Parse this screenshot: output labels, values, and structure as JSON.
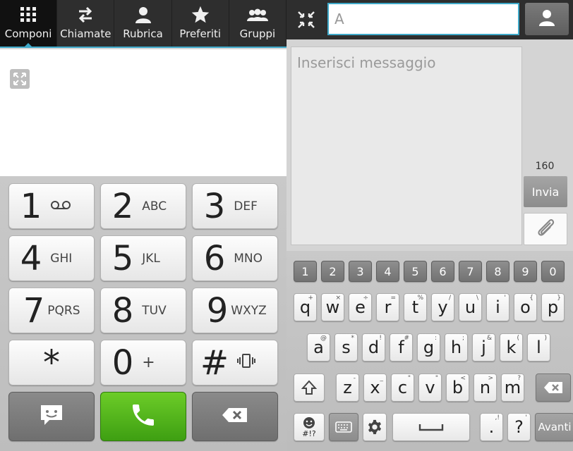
{
  "tabs": [
    {
      "label": "Componi",
      "icon": "dialpad-icon",
      "active": true
    },
    {
      "label": "Chiamate",
      "icon": "swap-arrows-icon",
      "active": false
    },
    {
      "label": "Rubrica",
      "icon": "person-icon",
      "active": false
    },
    {
      "label": "Preferiti",
      "icon": "star-icon",
      "active": false
    },
    {
      "label": "Gruppi",
      "icon": "group-icon",
      "active": false
    }
  ],
  "dialpad": {
    "keys": [
      {
        "num": "1",
        "sub": "",
        "icon": "voicemail-icon"
      },
      {
        "num": "2",
        "sub": "ABC"
      },
      {
        "num": "3",
        "sub": "DEF"
      },
      {
        "num": "4",
        "sub": "GHI"
      },
      {
        "num": "5",
        "sub": "JKL"
      },
      {
        "num": "6",
        "sub": "MNO"
      },
      {
        "num": "7",
        "sub": "PQRS"
      },
      {
        "num": "8",
        "sub": "TUV"
      },
      {
        "num": "9",
        "sub": "WXYZ"
      },
      {
        "num": "*",
        "sub": ""
      },
      {
        "num": "0",
        "sub": "+"
      },
      {
        "num": "#",
        "sub": "",
        "icon": "vibrate-icon"
      }
    ]
  },
  "message": {
    "to_value": "A",
    "placeholder": "Inserisci messaggio",
    "char_count": "160",
    "send_label": "Invia"
  },
  "keyboard": {
    "numbers": [
      "1",
      "2",
      "3",
      "4",
      "5",
      "6",
      "7",
      "8",
      "9",
      "0"
    ],
    "row1": [
      {
        "k": "q",
        "s": "+"
      },
      {
        "k": "w",
        "s": "×"
      },
      {
        "k": "e",
        "s": "÷"
      },
      {
        "k": "r",
        "s": "="
      },
      {
        "k": "t",
        "s": "%"
      },
      {
        "k": "y",
        "s": "/"
      },
      {
        "k": "u",
        "s": "\\"
      },
      {
        "k": "i",
        "s": "'"
      },
      {
        "k": "o",
        "s": "{"
      },
      {
        "k": "p",
        "s": "}"
      }
    ],
    "row2": [
      {
        "k": "a",
        "s": "@"
      },
      {
        "k": "s",
        "s": "*"
      },
      {
        "k": "d",
        "s": "!"
      },
      {
        "k": "f",
        "s": "#"
      },
      {
        "k": "g",
        "s": ":"
      },
      {
        "k": "h",
        "s": ";"
      },
      {
        "k": "j",
        "s": "&"
      },
      {
        "k": "k",
        "s": "("
      },
      {
        "k": "l",
        "s": ")"
      }
    ],
    "row3": [
      {
        "k": "z",
        "s": "-"
      },
      {
        "k": "x",
        "s": "_"
      },
      {
        "k": "c",
        "s": "\""
      },
      {
        "k": "v",
        "s": "\""
      },
      {
        "k": "b",
        "s": "<"
      },
      {
        "k": "n",
        "s": ">"
      },
      {
        "k": "m",
        "s": "?"
      }
    ],
    "symbols_label": "#!?",
    "punct_label": ".",
    "punct_sec": ",!",
    "question_label": "?",
    "question_sec": "'",
    "next_label": "Avanti"
  }
}
